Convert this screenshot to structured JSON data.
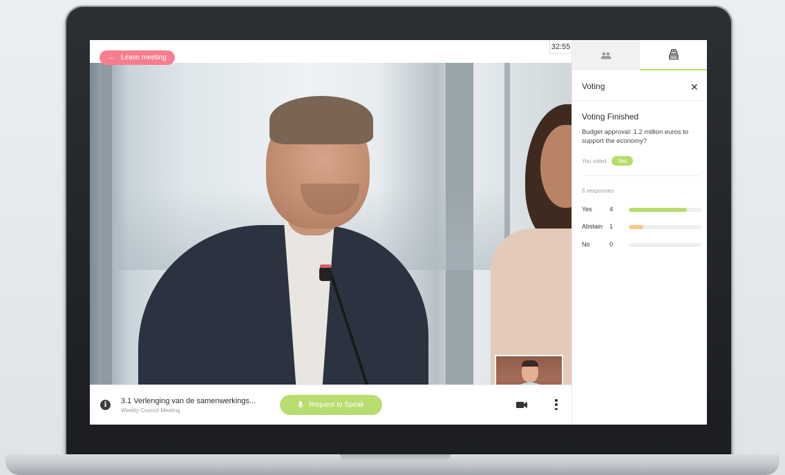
{
  "timer": "32:55",
  "leave_button": {
    "label": "Leave meeting",
    "icon": "arrow-left-icon"
  },
  "agenda": {
    "title": "3.1 Verlenging van de samenwerkings...",
    "subtitle": "Weekly Council Meeting"
  },
  "request_speak": {
    "label": "Request to Speak",
    "icon": "microphone-icon"
  },
  "toolbar": {
    "camera_icon": "video-camera-icon",
    "more_icon": "more-vertical-icon"
  },
  "tabs": [
    {
      "name": "participants",
      "icon": "participants-icon",
      "active": false
    },
    {
      "name": "voting",
      "icon": "ballot-box-icon",
      "active": true
    }
  ],
  "panel": {
    "title": "Voting",
    "status": "Voting Finished",
    "question": "Budget approval: 1.2 million euros to support the economy?",
    "you_voted_label": "You voted",
    "you_voted_value": "Yes",
    "responses_label": "5 responses",
    "total_responses": 5,
    "results": [
      {
        "label": "Yes",
        "count": "4",
        "fraction": 0.8,
        "color": "#b8dd6f"
      },
      {
        "label": "Abstain",
        "count": "1",
        "fraction": 0.2,
        "color": "#f9c98a"
      },
      {
        "label": "No",
        "count": "0",
        "fraction": 0.0,
        "color": "#efefef"
      }
    ]
  },
  "colors": {
    "accent_green": "#b8dd6f",
    "leave_red": "#f77e8e",
    "abstain_orange": "#f9c98a"
  }
}
